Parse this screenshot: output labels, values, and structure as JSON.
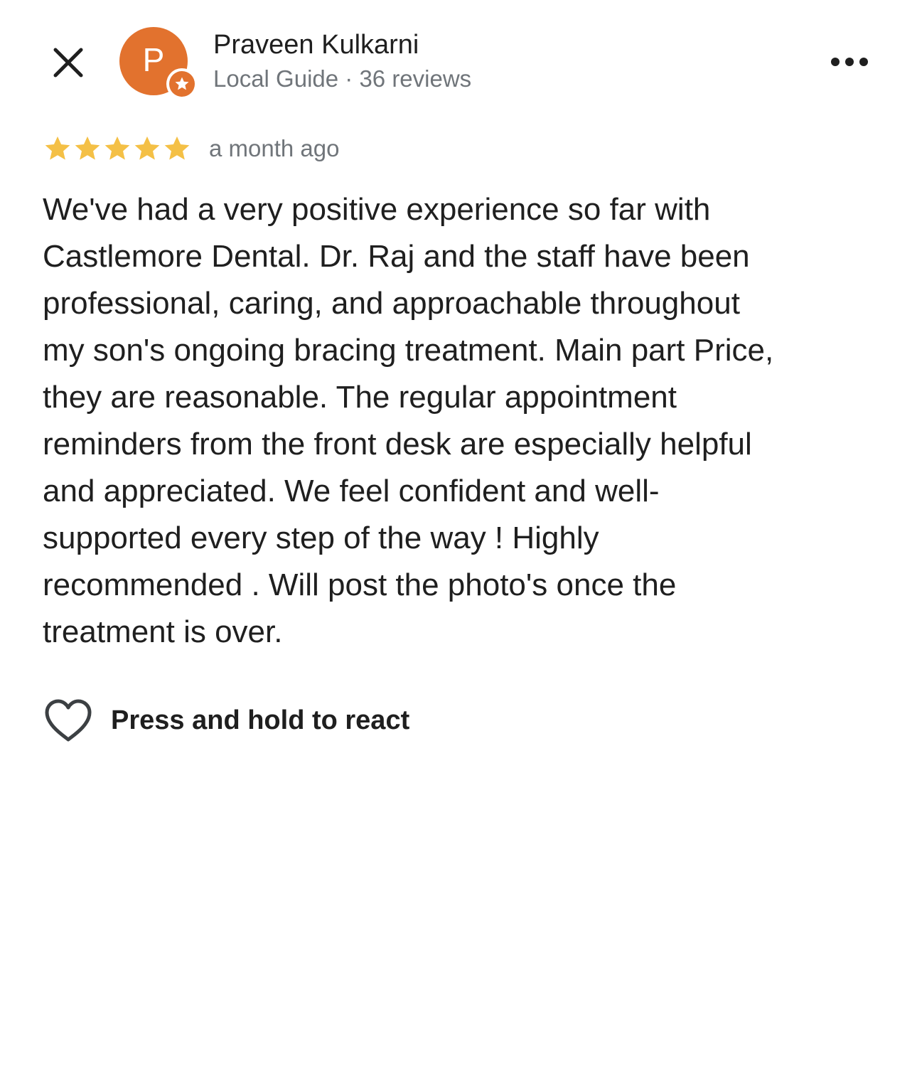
{
  "header": {
    "close_icon": "close-icon",
    "more_icon": "more-horizontal-icon"
  },
  "author": {
    "avatar_letter": "P",
    "avatar_color": "#e2722e",
    "badge_icon": "local-guide-star-icon",
    "name": "Praveen Kulkarni",
    "meta": "Local Guide · 36 reviews"
  },
  "review": {
    "rating": 5,
    "max_rating": 5,
    "star_color": "#f4c046",
    "date": "a month ago",
    "text": "We've had a very positive experience so far with\nCastlemore Dental. Dr. Raj and the staff have been\nprofessional, caring, and approachable throughout\nmy son's ongoing bracing treatment. Main part Price,\nthey are reasonable.  The regular appointment\nreminders from the front desk are especially helpful\nand appreciated. We feel confident and well-\nsupported every step of the way ! Highly\nrecommended . Will post the photo's once the\ntreatment is over."
  },
  "reaction": {
    "icon": "heart-outline-icon",
    "label": "Press and hold to react"
  }
}
